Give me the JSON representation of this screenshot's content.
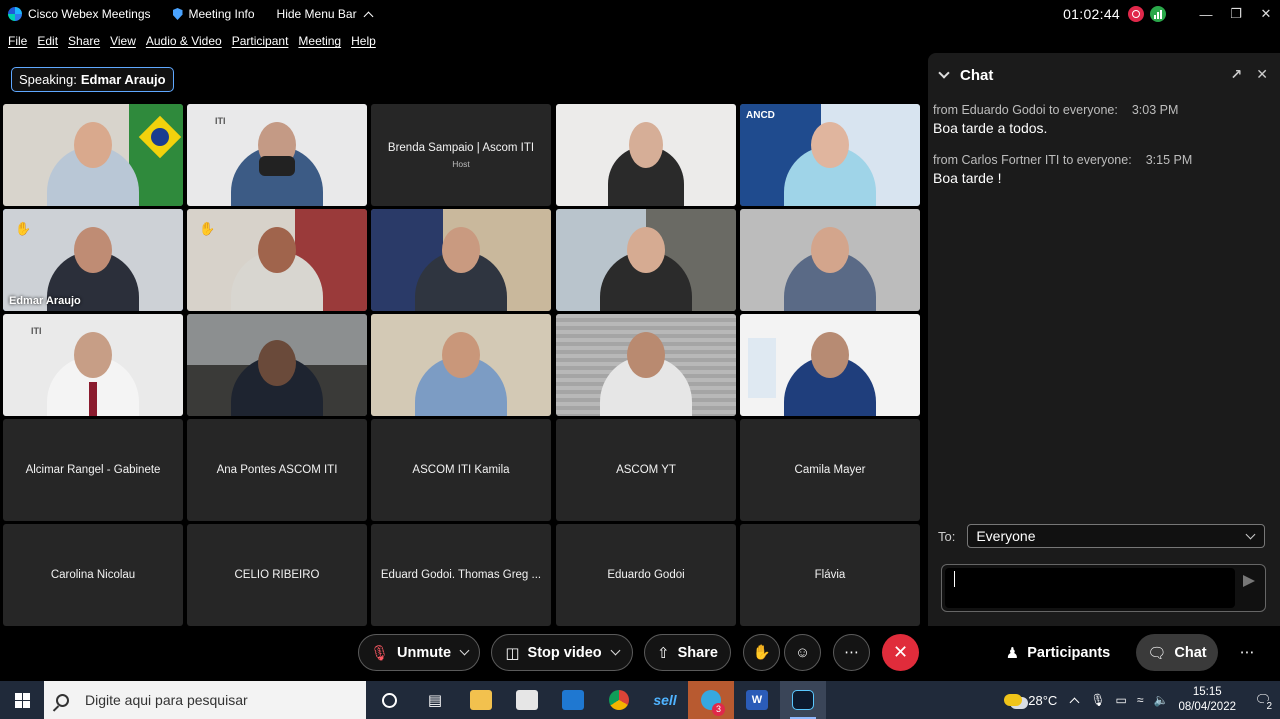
{
  "titlebar": {
    "app_title": "Cisco Webex Meetings",
    "meeting_info": "Meeting Info",
    "hide_menu": "Hide Menu Bar",
    "timer": "01:02:44"
  },
  "menu": [
    "File",
    "Edit",
    "Share",
    "View",
    "Audio & Video",
    "Participant",
    "Meeting",
    "Help"
  ],
  "speaking": {
    "label": "Speaking:",
    "name": "Edmar Araujo"
  },
  "tiles": {
    "brenda": {
      "name": "Brenda Sampaio | Ascom ITI",
      "role": "Host"
    },
    "edmar_label": "Edmar Araujo",
    "iti_logo": "ITI",
    "ancd_logo": "ANCD",
    "names_row4": [
      "Alcimar Rangel - Gabinete",
      "Ana Pontes ASCOM ITI",
      "ASCOM ITI Kamila",
      "ASCOM YT",
      "Camila Mayer"
    ],
    "names_row5": [
      "Carolina Nicolau",
      "CELIO RIBEIRO",
      "Eduard Godoi. Thomas Greg ...",
      "Eduardo Godoi",
      "Flávia"
    ]
  },
  "chat": {
    "title": "Chat",
    "messages": [
      {
        "meta": "from Eduardo Godoi to everyone:",
        "time": "3:03 PM",
        "text": "Boa tarde a todos."
      },
      {
        "meta": "from Carlos Fortner ITI to everyone:",
        "time": "3:15 PM",
        "text": "Boa tarde !"
      }
    ],
    "to_label": "To:",
    "to_value": "Everyone"
  },
  "controls": {
    "unmute": "Unmute",
    "stop_video": "Stop video",
    "share": "Share",
    "participants": "Participants",
    "chat": "Chat"
  },
  "taskbar": {
    "search_placeholder": "Digite aqui para pesquisar",
    "weather": "28°C",
    "time": "15:15",
    "date": "08/04/2022",
    "notifications": "2",
    "badge": "3",
    "sell_label": "sell"
  },
  "colors": {
    "accent": "#4d9cff",
    "leave": "#e02c3b",
    "raise_hand": "#f4b400"
  }
}
